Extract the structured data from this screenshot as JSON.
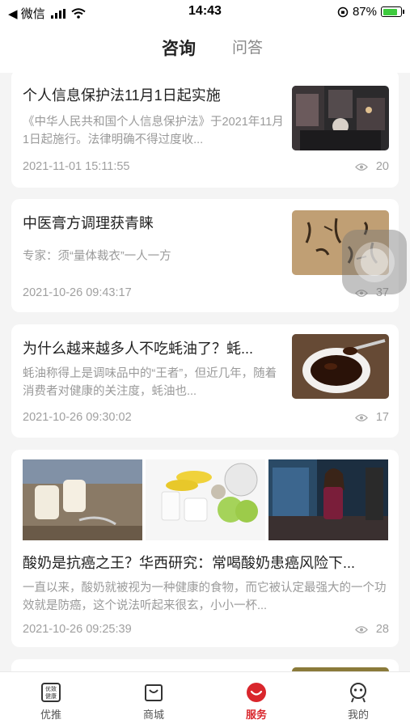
{
  "status_bar": {
    "back_app": "◀ 微信",
    "time": "14:43",
    "battery": "87%",
    "battery_level": 0.87
  },
  "header": {
    "tabs": [
      {
        "label": "咨询",
        "active": true
      },
      {
        "label": "问答",
        "active": false
      }
    ]
  },
  "articles": [
    {
      "title": "个人信息保护法11月1日起实施",
      "summary": "《中华人民共和国个人信息保护法》于2021年11月1日起施行。法律明确不得过度收...",
      "date": "2021-11-01 15:11:55",
      "views": "20",
      "thumbnail": "street-night-photo"
    },
    {
      "title": "中医膏方调理获青睐",
      "summary": "专家：须“量体裁衣”一人一方",
      "date": "2021-10-26 09:43:17",
      "views": "37",
      "thumbnail": "calligraphy-photo"
    },
    {
      "title": "为什么越来越多人不吃蚝油了？蚝...",
      "summary": "蚝油称得上是调味品中的“王者”，但近几年，随着消费者对健康的关注度，蚝油也...",
      "date": "2021-10-26 09:30:02",
      "views": "17",
      "thumbnail": "oyster-sauce-bowl-photo"
    },
    {
      "title": "酸奶是抗癌之王？华西研究：常喝酸奶患癌风险下...",
      "summary": "一直以来，酸奶就被视为一种健康的食物，而它被认定最强大的一个功效就是防癌，这个说法听起来很玄，小小一杯...",
      "date": "2021-10-26 09:25:39",
      "views": "28",
      "images": [
        "yogurt-jars-photo",
        "yogurt-fruit-photo",
        "woman-eating-yogurt-photo"
      ]
    }
  ],
  "bottom_nav": [
    {
      "label": "优推",
      "icon": "recommend-badge-icon",
      "badge_text": "优致\n健康",
      "active": false
    },
    {
      "label": "商城",
      "icon": "shopping-bag-icon",
      "active": false
    },
    {
      "label": "服务",
      "icon": "service-smile-icon",
      "active": true
    },
    {
      "label": "我的",
      "icon": "profile-face-icon",
      "active": false
    }
  ],
  "colors": {
    "accent": "#d9262c",
    "background": "#f4f4f4",
    "card": "#ffffff"
  }
}
